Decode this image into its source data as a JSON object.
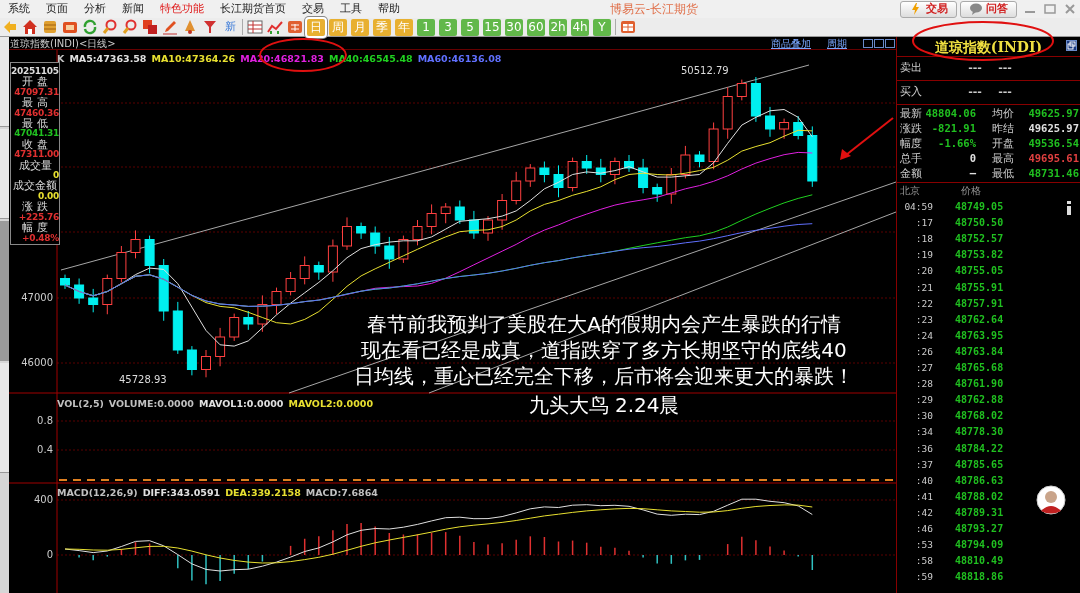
{
  "title_bar": {
    "menus": [
      {
        "label": "系统",
        "highlighted": false
      },
      {
        "label": "页面",
        "highlighted": false
      },
      {
        "label": "分析",
        "highlighted": false
      },
      {
        "label": "新闻",
        "highlighted": false
      },
      {
        "label": "特色功能",
        "highlighted": true
      },
      {
        "label": "长江期货首页",
        "highlighted": false
      },
      {
        "label": "交易",
        "highlighted": false
      },
      {
        "label": "工具",
        "highlighted": false
      },
      {
        "label": "帮助",
        "highlighted": false
      }
    ],
    "app_title": "博易云-长江期货",
    "buttons": [
      "交易",
      "问答"
    ]
  },
  "toolbar": {
    "new_label": "新",
    "periods": [
      {
        "label": "日",
        "selected": true,
        "color": "#e8b030"
      },
      {
        "label": "周",
        "selected": false,
        "color": "#e8b030"
      },
      {
        "label": "月",
        "selected": false,
        "color": "#e8b030"
      },
      {
        "label": "季",
        "selected": false,
        "color": "#e8b030"
      },
      {
        "label": "年",
        "selected": false,
        "color": "#e8b030"
      },
      {
        "label": "1",
        "selected": false,
        "color": "#62b84a"
      },
      {
        "label": "3",
        "selected": false,
        "color": "#62b84a"
      },
      {
        "label": "5",
        "selected": false,
        "color": "#62b84a"
      },
      {
        "label": "15",
        "selected": false,
        "color": "#62b84a"
      },
      {
        "label": "30",
        "selected": false,
        "color": "#62b84a"
      },
      {
        "label": "60",
        "selected": false,
        "color": "#62b84a"
      },
      {
        "label": "2h",
        "selected": false,
        "color": "#62b84a"
      },
      {
        "label": "4h",
        "selected": false,
        "color": "#62b84a"
      },
      {
        "label": "Y",
        "selected": false,
        "color": "#62b84a"
      }
    ]
  },
  "chart": {
    "title": "道琼指数(INDI)<日线>",
    "links": [
      "商品叠加",
      "周期"
    ],
    "legend": [
      {
        "label": "K",
        "color": "#c0c0c0"
      },
      {
        "label": "MA5:47363.58",
        "color": "#e0e0e0"
      },
      {
        "label": "MA10:47364.26",
        "color": "#e8e030"
      },
      {
        "label": "MA20:46821.83",
        "color": "#e020e0"
      },
      {
        "label": "MA40:46545.48",
        "color": "#20d020"
      },
      {
        "label": "MA60:46136.08",
        "color": "#6070ff"
      }
    ],
    "y_labels": [
      "47000",
      "46000"
    ],
    "high_mark": "50512.79",
    "low_mark": "45728.93",
    "info_panel": {
      "date": "20251105",
      "rows": [
        {
          "label": "开 盘",
          "value": "47097.31",
          "color": "#e03030"
        },
        {
          "label": "最 高",
          "value": "47460.36",
          "color": "#e03030"
        },
        {
          "label": "最 低",
          "value": "47041.31",
          "color": "#20c020"
        },
        {
          "label": "收 盘",
          "value": "47311.00",
          "color": "#e03030"
        },
        {
          "label": "成交量",
          "value": "0",
          "color": "#e8e030"
        },
        {
          "label": "成交金额",
          "value": "0.00",
          "color": "#e8e030"
        },
        {
          "label": "涨 跌",
          "value": "+225.76",
          "color": "#e03030"
        },
        {
          "label": "幅 度",
          "value": "+0.48%",
          "color": "#e03030"
        }
      ]
    },
    "volume": {
      "legend": [
        {
          "label": "VOL(2,5)",
          "color": "#c0c0c0"
        },
        {
          "label": "VOLUME:0.0000",
          "color": "#c0c0c0"
        },
        {
          "label": "MAVOL1:0.0000",
          "color": "#e0e0e0"
        },
        {
          "label": "MAVOL2:0.0000",
          "color": "#e8e030"
        }
      ],
      "y_labels": [
        "0.8",
        "0.4"
      ]
    },
    "macd": {
      "legend": [
        {
          "label": "MACD(12,26,9)",
          "color": "#c0c0c0"
        },
        {
          "label": "DIFF:343.0591",
          "color": "#e0e0e0"
        },
        {
          "label": "DEA:339.2158",
          "color": "#e8e030"
        },
        {
          "label": "MACD:7.6864",
          "color": "#c0c0c0"
        }
      ],
      "y_labels": [
        "400",
        "0"
      ]
    },
    "caption_lines": [
      "春节前我预判了美股在大A的假期内会产生暴跌的行情",
      "现在看已经是成真，道指跌穿了多方长期坚守的底线40",
      "日均线，重心已经完全下移，后市将会迎来更大的暴跌！",
      "九头大鸟 2.24晨"
    ]
  },
  "side_tabs": [
    {
      "selected": false
    },
    {
      "selected": false
    },
    {
      "selected": true
    },
    {
      "selected": false
    }
  ],
  "quote_panel": {
    "title": "道琼指数(INDI)",
    "sell": {
      "label": "卖出",
      "values": [
        "---",
        "---"
      ]
    },
    "buy": {
      "label": "买入",
      "values": [
        "---",
        "---"
      ]
    },
    "rows": [
      {
        "label": "最新",
        "value": "48804.06",
        "color": "#20c020"
      },
      {
        "label": "均价",
        "value": "49625.97",
        "color": "#20c020"
      },
      {
        "label": "涨跌",
        "value": "-821.91",
        "color": "#20c020"
      },
      {
        "label": "昨结",
        "value": "49625.97",
        "color": "#e0e0e0"
      },
      {
        "label": "幅度",
        "value": "-1.66%",
        "color": "#20c020"
      },
      {
        "label": "开盘",
        "value": "49536.54",
        "color": "#20c020"
      },
      {
        "label": "总手",
        "value": "0",
        "color": "#e0e0e0"
      },
      {
        "label": "最高",
        "value": "49695.61",
        "color": "#e04040"
      },
      {
        "label": "金额",
        "value": "—",
        "color": "#e0e0e0"
      },
      {
        "label": "最低",
        "value": "48731.46",
        "color": "#20c020"
      }
    ],
    "tick_header": [
      "北京",
      "价格"
    ],
    "ticks": [
      {
        "time": "04:59",
        "price": "48749.05"
      },
      {
        "time": ":17",
        "price": "48750.50"
      },
      {
        "time": ":18",
        "price": "48752.57"
      },
      {
        "time": ":19",
        "price": "48753.82"
      },
      {
        "time": ":20",
        "price": "48755.05"
      },
      {
        "time": ":21",
        "price": "48755.91"
      },
      {
        "time": ":22",
        "price": "48757.91"
      },
      {
        "time": ":23",
        "price": "48762.64"
      },
      {
        "time": ":24",
        "price": "48763.95"
      },
      {
        "time": ":26",
        "price": "48763.84"
      },
      {
        "time": ":27",
        "price": "48765.68"
      },
      {
        "time": ":28",
        "price": "48761.90"
      },
      {
        "time": ":29",
        "price": "48762.88"
      },
      {
        "time": ":30",
        "price": "48768.02"
      },
      {
        "time": ":34",
        "price": "48778.30"
      },
      {
        "time": ":36",
        "price": "48784.22"
      },
      {
        "time": ":37",
        "price": "48785.65"
      },
      {
        "time": ":40",
        "price": "48786.63"
      },
      {
        "time": ":41",
        "price": "48788.02"
      },
      {
        "time": ":42",
        "price": "48789.31"
      },
      {
        "time": ":46",
        "price": "48793.27"
      },
      {
        "time": ":53",
        "price": "48794.09"
      },
      {
        "time": ":58",
        "price": "48810.49"
      },
      {
        "time": ":59",
        "price": "48818.86"
      }
    ]
  }
}
